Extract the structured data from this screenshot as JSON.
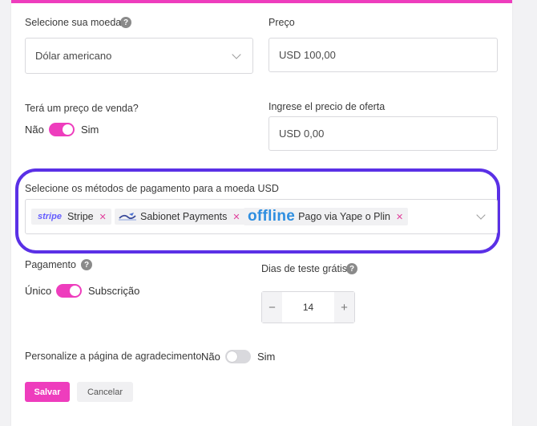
{
  "colors": {
    "accent": "#ee3dbd",
    "highlight": "#5a30e6",
    "stripe": "#635bff",
    "offline": "#2e8ee0"
  },
  "currency": {
    "label": "Selecione sua moeda",
    "value": "Dólar americano"
  },
  "price": {
    "label": "Preço",
    "value": "USD 100,00"
  },
  "sale": {
    "label": "Terá um preço de venda?",
    "off_label": "Não",
    "on_label": "Sim",
    "enabled": true
  },
  "offer": {
    "label": "Ingrese el precio de oferta",
    "value": "USD 0,00"
  },
  "payment_methods": {
    "label": "Selecione os métodos de pagamento para a moeda USD",
    "chips": [
      {
        "logo": "stripe",
        "label": "Stripe"
      },
      {
        "logo": "sabionet-icon",
        "label": "Sabionet Payments"
      },
      {
        "logo": "offline",
        "label": "Pago via Yape o Plin"
      }
    ]
  },
  "payment": {
    "label": "Pagamento",
    "left_label": "Único",
    "right_label": "Subscrição",
    "enabled": true
  },
  "trial": {
    "label": "Dias de teste grátis",
    "value": "14",
    "minus": "−",
    "plus": "+"
  },
  "thanks": {
    "label": "Personalize a página de agradecimento",
    "off_label": "Não",
    "on_label": "Sim",
    "enabled": false
  },
  "actions": {
    "save": "Salvar",
    "cancel": "Cancelar"
  }
}
